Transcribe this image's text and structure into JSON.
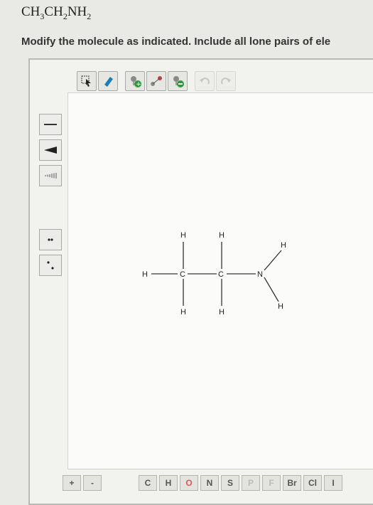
{
  "question": {
    "formula_parts": [
      "CH",
      "3",
      "CH",
      "2",
      "NH",
      "2"
    ],
    "instruction": "Modify the molecule as indicated. Include all lone pairs of ele"
  },
  "toolbar": {
    "tools": [
      "select-tool",
      "eraser-tool",
      "add-charge-tool",
      "add-atom-tool",
      "remove-charge-tool",
      "undo-tool",
      "redo-tool"
    ]
  },
  "side_toolbar": {
    "tools": [
      "single-bond-tool",
      "wedge-bond-tool",
      "hash-bond-tool",
      "lone-pair-tool",
      "radical-tool"
    ]
  },
  "molecule": {
    "atoms": {
      "h1": "H",
      "c1": "C",
      "c2": "C",
      "n1": "N",
      "h_c1_top": "H",
      "h_c1_bottom": "H",
      "h_c2_top": "H",
      "h_c2_bottom": "H",
      "h_n_top": "H",
      "h_n_bottom": "H"
    }
  },
  "element_bar": {
    "buttons": [
      "+",
      "-"
    ],
    "elements": [
      "C",
      "H",
      "O",
      "N",
      "S",
      "P",
      "F",
      "Br",
      "Cl",
      "I"
    ]
  },
  "colors": {
    "background": "#e9e9e6",
    "canvas": "#fbfbf9",
    "eraser_blue": "#1d7fb8",
    "add_green": "#2e9a3c"
  }
}
